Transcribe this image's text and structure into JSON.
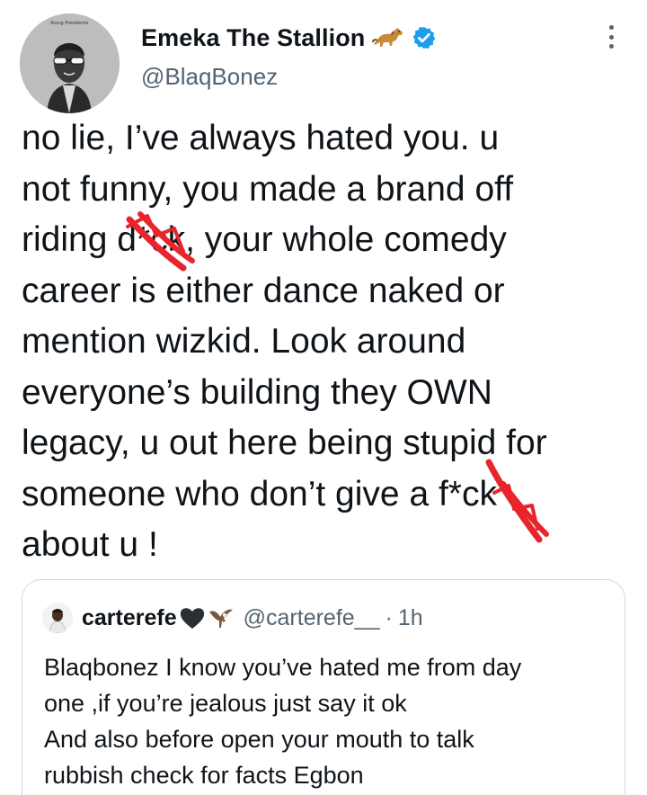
{
  "tweet": {
    "author": {
      "display_name": "Emeka The Stallion",
      "emoji": "horse-emoji",
      "verified_icon": "verified-badge-icon",
      "handle": "@BlaqBonez",
      "avatar_caption": "Young Presidents"
    },
    "more_icon": "more-options-icon",
    "text": "no lie, I’ve always hated you. u\nnot funny, you made a brand off\nriding d*ck, your whole comedy\ncareer is either dance naked or\nmention wizkid. Look around\neveryone’s building they OWN\nlegacy, u out here being stupid for\nsomeone who don’t give a f*ck\nabout u !",
    "redaction_color": "#e8242d"
  },
  "quote": {
    "author": {
      "display_name": "carterefe",
      "emojis": [
        "black-heart-emoji",
        "eagle-emoji"
      ],
      "handle": "@carterefe__",
      "separator": "·",
      "time": "1h"
    },
    "lines": [
      "Blaqbonez I know you’ve hated me from day",
      "one ,if you’re jealous just say it ok",
      "And also before open your mouth to talk",
      "rubbish check for facts Egbon"
    ]
  },
  "colors": {
    "text": "#0f1419",
    "secondary": "#536471",
    "verified": "#1d9bf0",
    "border": "#cfd9de"
  }
}
